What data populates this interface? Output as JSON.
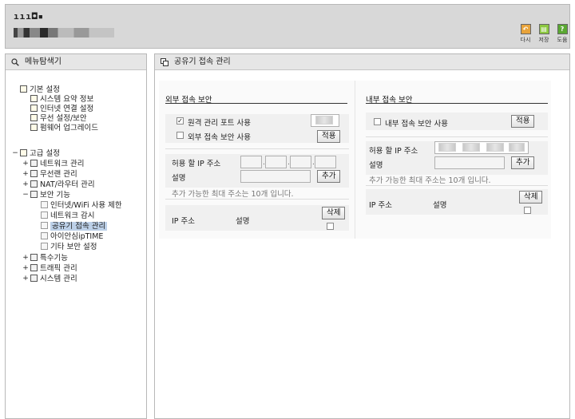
{
  "header": {
    "logo": "ııı◘▪",
    "tools": [
      {
        "label": "다시",
        "icon": "undo-icon",
        "color": "#e8a33a",
        "glyph": "↶"
      },
      {
        "label": "저장",
        "icon": "save-icon",
        "color": "#8cc840",
        "glyph": "▤"
      },
      {
        "label": "도움",
        "icon": "help-icon",
        "color": "#5aa832",
        "glyph": "?"
      }
    ]
  },
  "sidebar": {
    "title": "메뉴탐색기",
    "basic_group": "기본 설정",
    "basic_items": [
      "시스템 요약 정보",
      "인터넷 연결 설정",
      "무선 설정/보안",
      "펌웨어 업그레이드"
    ],
    "advanced_group": "고급 설정",
    "advanced_items": [
      "네트워크 관리",
      "무선랜 관리",
      "NAT/라우터 관리",
      "보안 기능"
    ],
    "security_items": [
      "인터넷/WiFi 사용 제한",
      "네트워크 감시",
      "공유기 접속 관리",
      "아이안심ipTIME",
      "기타 보안 설정"
    ],
    "more_items": [
      "특수기능",
      "트래픽 관리",
      "시스템 관리"
    ]
  },
  "main": {
    "title": "공유기 접속 관리",
    "external": {
      "title": "외부 접속 보안",
      "remote_port_label": "원격 관리 포트 사용",
      "remote_port_checked": true,
      "external_access_label": "외부 접속 보안 사용",
      "external_access_checked": false,
      "apply_label": "적용",
      "allowed_ip_label": "허용 할 IP 주소",
      "desc_label": "설명",
      "add_label": "추가",
      "note": "추가 가능한 최대 주소는 10개 입니다.",
      "col_ip": "IP 주소",
      "col_desc": "설명",
      "delete_label": "삭제"
    },
    "internal": {
      "title": "내부 접속 보안",
      "use_label": "내부 접속 보안 사용",
      "use_checked": false,
      "apply_label": "적용",
      "allowed_ip_label": "허용 할 IP 주소",
      "desc_label": "설명",
      "add_label": "추가",
      "note": "추가 가능한 최대 주소는 10개 입니다.",
      "col_ip": "IP 주소",
      "col_desc": "설명",
      "delete_label": "삭제"
    }
  }
}
